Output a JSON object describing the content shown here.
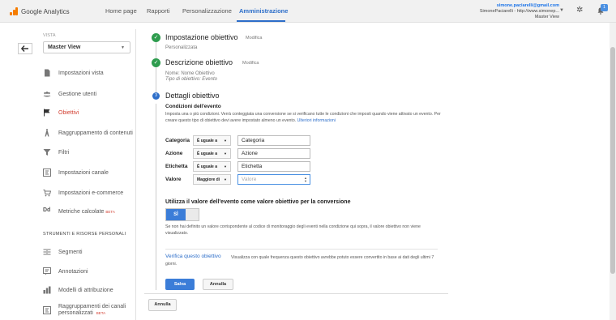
{
  "header": {
    "logo_text": "Google Analytics",
    "nav": [
      "Home page",
      "Rapporti",
      "Personalizzazione",
      "Amministrazione"
    ],
    "active_nav": "Amministrazione",
    "account_email": "simone.paciarelli@gmail.com",
    "account_property": "SimonePaciarelli - http://www.simonep...",
    "account_view": "Master View",
    "notifications_count": "1"
  },
  "sidebar": {
    "vista_label": "VISTA",
    "view_selected": "Master View",
    "items": [
      {
        "label": "Impostazioni vista",
        "icon": "page-icon"
      },
      {
        "label": "Gestione utenti",
        "icon": "users-icon"
      },
      {
        "label": "Obiettivi",
        "icon": "flag-icon",
        "active": true
      },
      {
        "label": "Raggruppamento di contenuti",
        "icon": "person-walk-icon"
      },
      {
        "label": "Filtri",
        "icon": "filter-icon"
      },
      {
        "label": "Impostazioni canale",
        "icon": "channel-icon"
      },
      {
        "label": "Impostazioni e-commerce",
        "icon": "cart-icon"
      },
      {
        "label": "Metriche calcolate",
        "icon": "dd-icon",
        "beta": "BETA"
      }
    ],
    "section_label": "STRUMENTI E RISORSE PERSONALI",
    "tools": [
      {
        "label": "Segmenti",
        "icon": "segments-icon"
      },
      {
        "label": "Annotazioni",
        "icon": "annotation-icon"
      },
      {
        "label": "Modelli di attribuzione",
        "icon": "bar-chart-icon"
      },
      {
        "label": "Raggruppamenti dei canali personalizzati",
        "icon": "channel-group-icon",
        "beta": "BETA"
      }
    ]
  },
  "goal": {
    "step1_title": "Impostazione obiettivo",
    "step1_edit": "Modifica",
    "step1_value": "Personalizzata",
    "step2_title": "Descrizione obiettivo",
    "step2_edit": "Modifica",
    "step2_name": "Nome: Nome Obiettivo",
    "step2_type": "Tipo di obiettivo: Evento",
    "step3_number": "3",
    "step3_title": "Dettagli obiettivo",
    "conditions_title": "Condizioni dell'evento",
    "conditions_desc": "Imposta una o più condizioni. Verrà conteggiata una conversione se si verificano tutte le condizioni che imposti quando viene attivato un evento. Per creare questo tipo di obiettivo devi avere impostato almeno un evento.",
    "conditions_more": "Ulteriori informazioni",
    "rows": [
      {
        "label": "Categoria",
        "operator": "È uguale a",
        "value": "Categoria"
      },
      {
        "label": "Azione",
        "operator": "È uguale a",
        "value": "Azione"
      },
      {
        "label": "Etichetta",
        "operator": "È uguale a",
        "value": "Etichetta"
      }
    ],
    "value_row": {
      "label": "Valore",
      "operator": "Maggiore di",
      "placeholder": "Valore"
    },
    "use_value_title": "Utilizza il valore dell'evento come valore obiettivo per la conversione",
    "toggle_label": "SÌ",
    "use_value_desc": "Se non hai definito un valore corrispondente al codice di monitoraggio degli eventi nella condizione qui sopra, il valore obiettivo non viene visualizzato.",
    "verify_link": "Verifica questo obiettivo",
    "verify_desc": "Visualizza con quale frequenza questo obiettivo avrebbe potuto essere convertito in base ai dati degli ultimi 7 giorni.",
    "save_label": "Salva",
    "cancel_label": "Annulla",
    "bottom_cancel_label": "Annulla"
  },
  "colors": {
    "accent": "#2d6ec9",
    "success": "#2e9c4e",
    "active_nav_item": "#d23f31",
    "logo": "#f57c00"
  }
}
